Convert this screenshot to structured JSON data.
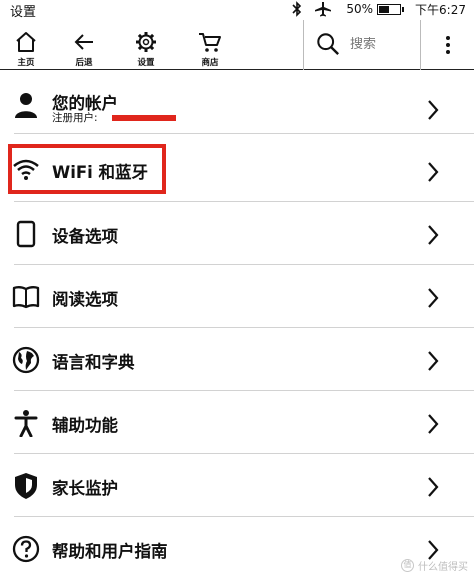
{
  "status_bar": {
    "title": "设置",
    "battery_percent": "50%",
    "battery_level": 0.5,
    "time": "下午6:27",
    "icons": [
      "bluetooth-icon",
      "airplane-mode-icon",
      "battery-icon"
    ]
  },
  "toolbar": {
    "home_label": "主页",
    "back_label": "后退",
    "settings_label": "设置",
    "store_label": "商店",
    "search_placeholder": "搜索",
    "icons": [
      "home-icon",
      "back-arrow-icon",
      "gear-icon",
      "cart-icon",
      "search-icon",
      "more-vertical-icon"
    ]
  },
  "settings": {
    "items": [
      {
        "label": "您的帐户",
        "sub": "注册用户:",
        "icon": "person-icon"
      },
      {
        "label": "WiFi 和蓝牙",
        "icon": "wifi-icon"
      },
      {
        "label": "设备选项",
        "icon": "device-icon"
      },
      {
        "label": "阅读选项",
        "icon": "book-icon"
      },
      {
        "label": "语言和字典",
        "icon": "globe-icon"
      },
      {
        "label": "辅助功能",
        "icon": "accessibility-icon"
      },
      {
        "label": "家长监护",
        "icon": "shield-icon"
      },
      {
        "label": "帮助和用户指南",
        "icon": "help-icon"
      }
    ]
  },
  "annotation": {
    "highlight_color": "#e0261c",
    "redaction_color": "#e0261c"
  },
  "watermark": {
    "text": "什么值得买"
  }
}
